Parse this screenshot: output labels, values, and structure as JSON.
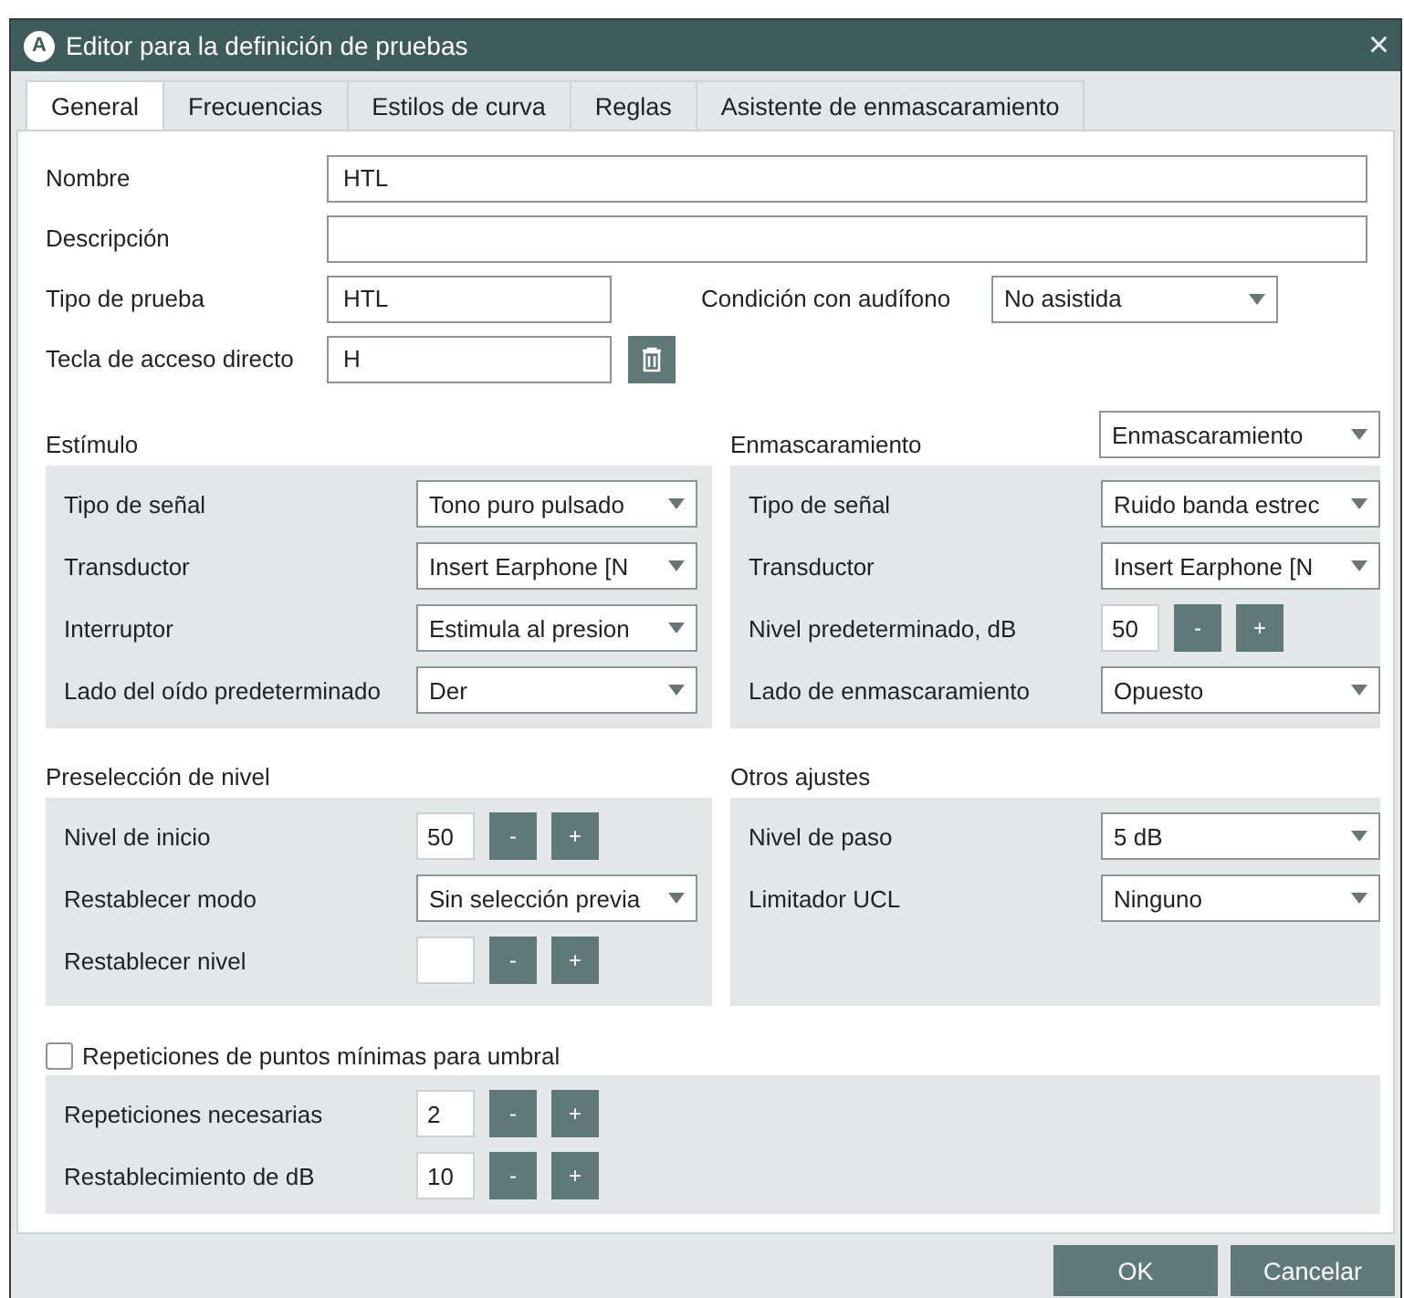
{
  "window": {
    "logo": "A",
    "title": "Editor para la definición de pruebas",
    "close": "×"
  },
  "tabs": [
    {
      "label": "General",
      "selected": true
    },
    {
      "label": "Frecuencias",
      "selected": false
    },
    {
      "label": "Estilos de curva",
      "selected": false
    },
    {
      "label": "Reglas",
      "selected": false
    },
    {
      "label": "Asistente de enmascaramiento",
      "selected": false
    }
  ],
  "name": {
    "label": "Nombre",
    "value": "HTL"
  },
  "description": {
    "label": "Descripción"
  },
  "test_type": {
    "label": "Tipo de prueba",
    "value": "HTL"
  },
  "aided_condition": {
    "label": "Condición con audífono",
    "value": "No asistida"
  },
  "hotkey": {
    "label": "Tecla de acceso directo",
    "value": "H"
  },
  "stimulus": {
    "title": "Estímulo",
    "rows": [
      {
        "kind": "dropdown",
        "label": "Tipo de señal",
        "value": "Tono puro pulsado"
      },
      {
        "kind": "dropdown",
        "label": "Transductor",
        "value": "Insert Earphone [N"
      },
      {
        "kind": "dropdown",
        "label": "Interruptor",
        "value": "Estimula al presion"
      },
      {
        "kind": "dropdown",
        "label": "Lado del oído predeterminado",
        "value": "Der"
      }
    ]
  },
  "masking": {
    "title": "Enmascaramiento",
    "mode": "Enmascaramiento",
    "rows": [
      {
        "kind": "dropdown",
        "label": "Tipo de señal",
        "value": "Ruido banda estrec"
      },
      {
        "kind": "dropdown",
        "label": "Transductor",
        "value": "Insert Earphone [N"
      },
      {
        "kind": "numeric",
        "label": "Nivel predeterminado, dB",
        "value": "50",
        "minus": "-",
        "plus": "+"
      },
      {
        "kind": "dropdown",
        "label": "Lado de enmascaramiento",
        "value": "Opuesto"
      }
    ]
  },
  "level_preset": {
    "title": "Preselección de nivel",
    "rows": [
      {
        "kind": "numeric",
        "label": "Nivel de inicio",
        "value": "50",
        "minus": "-",
        "plus": "+"
      },
      {
        "kind": "dropdown",
        "label": "Restablecer modo",
        "value": "Sin selección previa"
      },
      {
        "kind": "numeric",
        "label": "Restablecer nivel",
        "minus": "-",
        "plus": "+"
      }
    ]
  },
  "other_settings": {
    "title": "Otros ajustes",
    "rows": [
      {
        "kind": "dropdown",
        "label": "Nivel de paso",
        "value": "5 dB"
      },
      {
        "kind": "dropdown",
        "label": "Limitador UCL",
        "value": "Ninguno"
      }
    ]
  },
  "repetitions": {
    "label": "Repeticiones de puntos mínimas para umbral",
    "checked": false,
    "rows": [
      {
        "kind": "numeric",
        "label": "Repeticiones necesarias",
        "value": "2",
        "minus": "-",
        "plus": "+"
      },
      {
        "kind": "numeric",
        "label": "Restablecimiento de dB",
        "value": "10",
        "minus": "-",
        "plus": "+"
      }
    ]
  },
  "buttons": [
    {
      "label": "OK"
    },
    {
      "label": "Cancelar"
    }
  ]
}
